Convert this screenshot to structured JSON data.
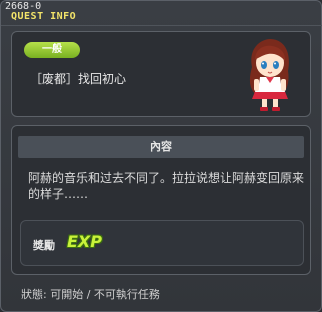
{
  "window": {
    "quest_id": "2668-0",
    "title": "QUEST INFO"
  },
  "quest": {
    "category": "一般",
    "title": "［废都］找回初心"
  },
  "content": {
    "header": "內容",
    "description": "阿赫的音乐和过去不同了。拉拉说想让阿赫变回原来的样子……"
  },
  "reward": {
    "label": "獎勵",
    "exp_icon_text": "EXP"
  },
  "status_text": "狀態: 可開始 / 不可執行任務",
  "colors": {
    "badge": "#8fc62e",
    "title_yellow": "#f3e46a",
    "exp_green": "#c9f23a"
  }
}
